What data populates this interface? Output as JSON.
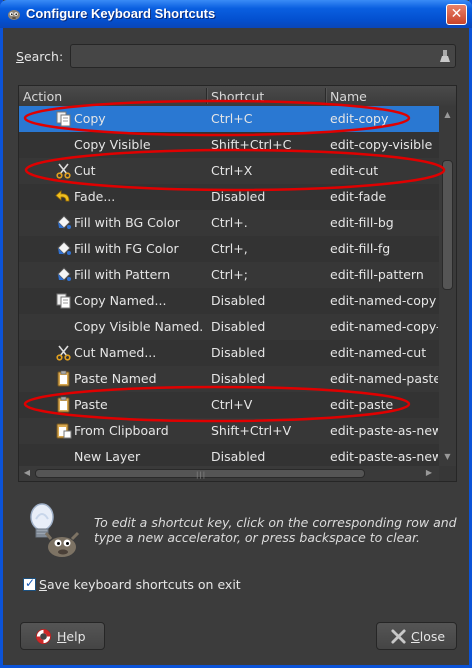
{
  "window": {
    "title": "Configure Keyboard Shortcuts",
    "close_glyph": "✕"
  },
  "search": {
    "label_prefix": "S",
    "label_rest": "earch:",
    "value": "",
    "placeholder": "",
    "clear_icon": "clear-icon"
  },
  "table": {
    "columns": {
      "action": "Action",
      "shortcut": "Shortcut",
      "name": "Name"
    },
    "rows": [
      {
        "action": "Copy",
        "shortcut": "Ctrl+C",
        "name": "edit-copy",
        "icon": "copy-icon",
        "selected": true,
        "annotated": true
      },
      {
        "action": "Copy Visible",
        "shortcut": "Shift+Ctrl+C",
        "name": "edit-copy-visible",
        "icon": "",
        "selected": false,
        "annotated": false
      },
      {
        "action": "Cut",
        "shortcut": "Ctrl+X",
        "name": "edit-cut",
        "icon": "scissors-icon",
        "selected": false,
        "annotated": true
      },
      {
        "action": "Fade...",
        "shortcut": "Disabled",
        "name": "edit-fade",
        "icon": "undo-arrow-icon",
        "selected": false,
        "annotated": false
      },
      {
        "action": "Fill with BG Color",
        "shortcut": "Ctrl+.",
        "name": "edit-fill-bg",
        "icon": "bucket-fill-icon",
        "selected": false,
        "annotated": false
      },
      {
        "action": "Fill with FG Color",
        "shortcut": "Ctrl+,",
        "name": "edit-fill-fg",
        "icon": "bucket-fill-icon",
        "selected": false,
        "annotated": false
      },
      {
        "action": "Fill with Pattern",
        "shortcut": "Ctrl+;",
        "name": "edit-fill-pattern",
        "icon": "bucket-fill-icon",
        "selected": false,
        "annotated": false
      },
      {
        "action": "Copy Named...",
        "shortcut": "Disabled",
        "name": "edit-named-copy",
        "icon": "copy-icon",
        "selected": false,
        "annotated": false
      },
      {
        "action": "Copy Visible Named...",
        "shortcut": "Disabled",
        "name": "edit-named-copy-v",
        "icon": "",
        "selected": false,
        "annotated": false
      },
      {
        "action": "Cut Named...",
        "shortcut": "Disabled",
        "name": "edit-named-cut",
        "icon": "scissors-icon",
        "selected": false,
        "annotated": false
      },
      {
        "action": "Paste Named",
        "shortcut": "Disabled",
        "name": "edit-named-paste",
        "icon": "paste-icon",
        "selected": false,
        "annotated": false
      },
      {
        "action": "Paste",
        "shortcut": "Ctrl+V",
        "name": "edit-paste",
        "icon": "paste-icon",
        "selected": false,
        "annotated": true
      },
      {
        "action": "From Clipboard",
        "shortcut": "Shift+Ctrl+V",
        "name": "edit-paste-as-new",
        "icon": "clipboard-icon",
        "selected": false,
        "annotated": false
      },
      {
        "action": "New Layer",
        "shortcut": "Disabled",
        "name": "edit-paste-as-new",
        "icon": "",
        "selected": false,
        "annotated": false
      }
    ]
  },
  "hint": {
    "text": "To edit a shortcut key, click on the corresponding row and type a new accelerator, or press backspace to clear.",
    "icon": "lightbulb-wilber-icon"
  },
  "save_option": {
    "checked": true,
    "label_prefix": "S",
    "label_rest": "ave keyboard shortcuts on exit"
  },
  "buttons": {
    "help": {
      "label_prefix": "H",
      "label_rest": "elp",
      "icon": "lifebuoy-icon"
    },
    "close": {
      "label_prefix": "C",
      "label_rest": "lose",
      "icon": "close-x-icon"
    }
  },
  "colors": {
    "selection": "#2a78d2",
    "annotation": "#e00000",
    "titlebar": "#0a5fe0",
    "background": "#3c3c3c"
  }
}
